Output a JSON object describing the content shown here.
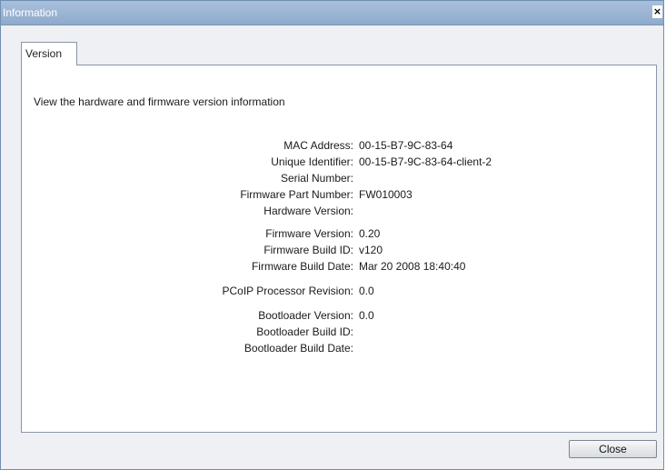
{
  "window": {
    "title": "Information",
    "close_glyph": "×"
  },
  "tabs": [
    {
      "label": "Version"
    }
  ],
  "description": "View the hardware and firmware version information",
  "fields": [
    {
      "label": "MAC Address:",
      "value": "00-15-B7-9C-83-64"
    },
    {
      "label": "Unique Identifier:",
      "value": "00-15-B7-9C-83-64-client-2"
    },
    {
      "label": "Serial Number:",
      "value": ""
    },
    {
      "label": "Firmware Part Number:",
      "value": "FW010003"
    },
    {
      "label": "Hardware Version:",
      "value": ""
    },
    {
      "label": "Firmware Version:",
      "value": "0.20"
    },
    {
      "label": "Firmware Build ID:",
      "value": "v120"
    },
    {
      "label": "Firmware Build Date:",
      "value": "Mar 20 2008 18:40:40"
    },
    {
      "label": "PCoIP Processor Revision:",
      "value": "0.0"
    },
    {
      "label": "Bootloader Version:",
      "value": "0.0"
    },
    {
      "label": "Bootloader Build ID:",
      "value": ""
    },
    {
      "label": "Bootloader Build Date:",
      "value": ""
    }
  ],
  "buttons": {
    "close_label": "Close"
  }
}
